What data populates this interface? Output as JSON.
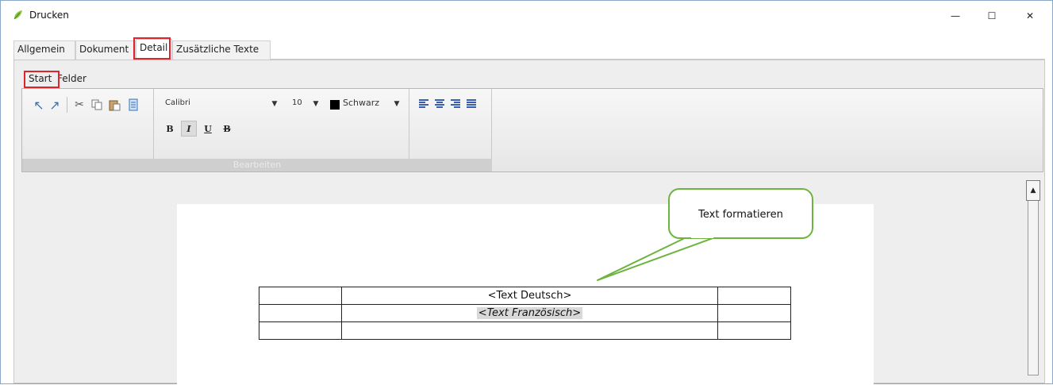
{
  "window": {
    "title": "Drucken",
    "minimize": "—",
    "maximize": "☐",
    "close": "✕"
  },
  "tabs": [
    "Allgemein",
    "Dokument",
    "Detail",
    "Zusätzliche Texte"
  ],
  "ribbon": {
    "tabs": [
      "Start",
      "Felder"
    ],
    "font": "Calibri",
    "size": "10",
    "color_name": "Schwarz",
    "format": {
      "bold": "B",
      "italic": "I",
      "underline": "U",
      "strike": "B"
    },
    "group_label": "Bearbeiten"
  },
  "document": {
    "table": [
      [
        "",
        "<Text Deutsch>",
        ""
      ],
      [
        "",
        "<Text Französisch>",
        ""
      ],
      [
        "",
        "",
        ""
      ]
    ]
  },
  "callout": {
    "text": "Text formatieren",
    "color": "#6db33f"
  },
  "colors": {
    "highlight": "#e0242e",
    "accent": "#3a6fb5"
  }
}
